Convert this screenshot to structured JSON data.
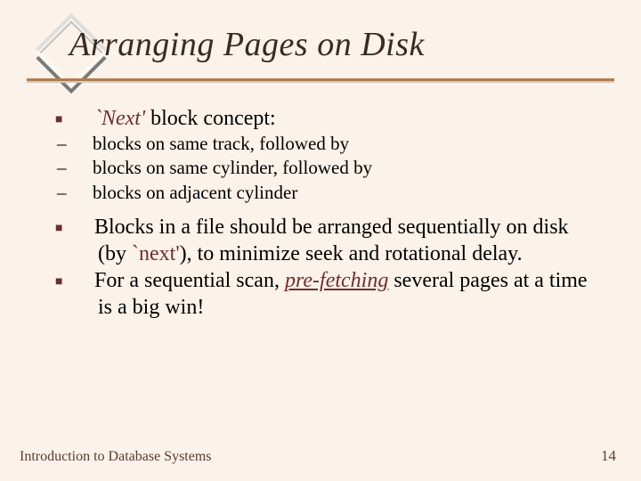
{
  "title": "Arranging Pages on Disk",
  "bullets": {
    "b1": {
      "accent": "`Next'",
      "rest": " block concept:",
      "subs": [
        "blocks on same track, followed by",
        "blocks on same cylinder, followed by",
        "blocks on adjacent cylinder"
      ]
    },
    "b2": {
      "pre": "Blocks in a file should be arranged sequentially on disk (by ",
      "accent": "`next'",
      "post": "), to minimize seek and rotational delay."
    },
    "b3": {
      "pre": "For a sequential scan, ",
      "accent": "pre-fetching",
      "post": " several pages at a time is a big win!"
    }
  },
  "footer": {
    "left": "Introduction to Database Systems",
    "right": "14"
  }
}
